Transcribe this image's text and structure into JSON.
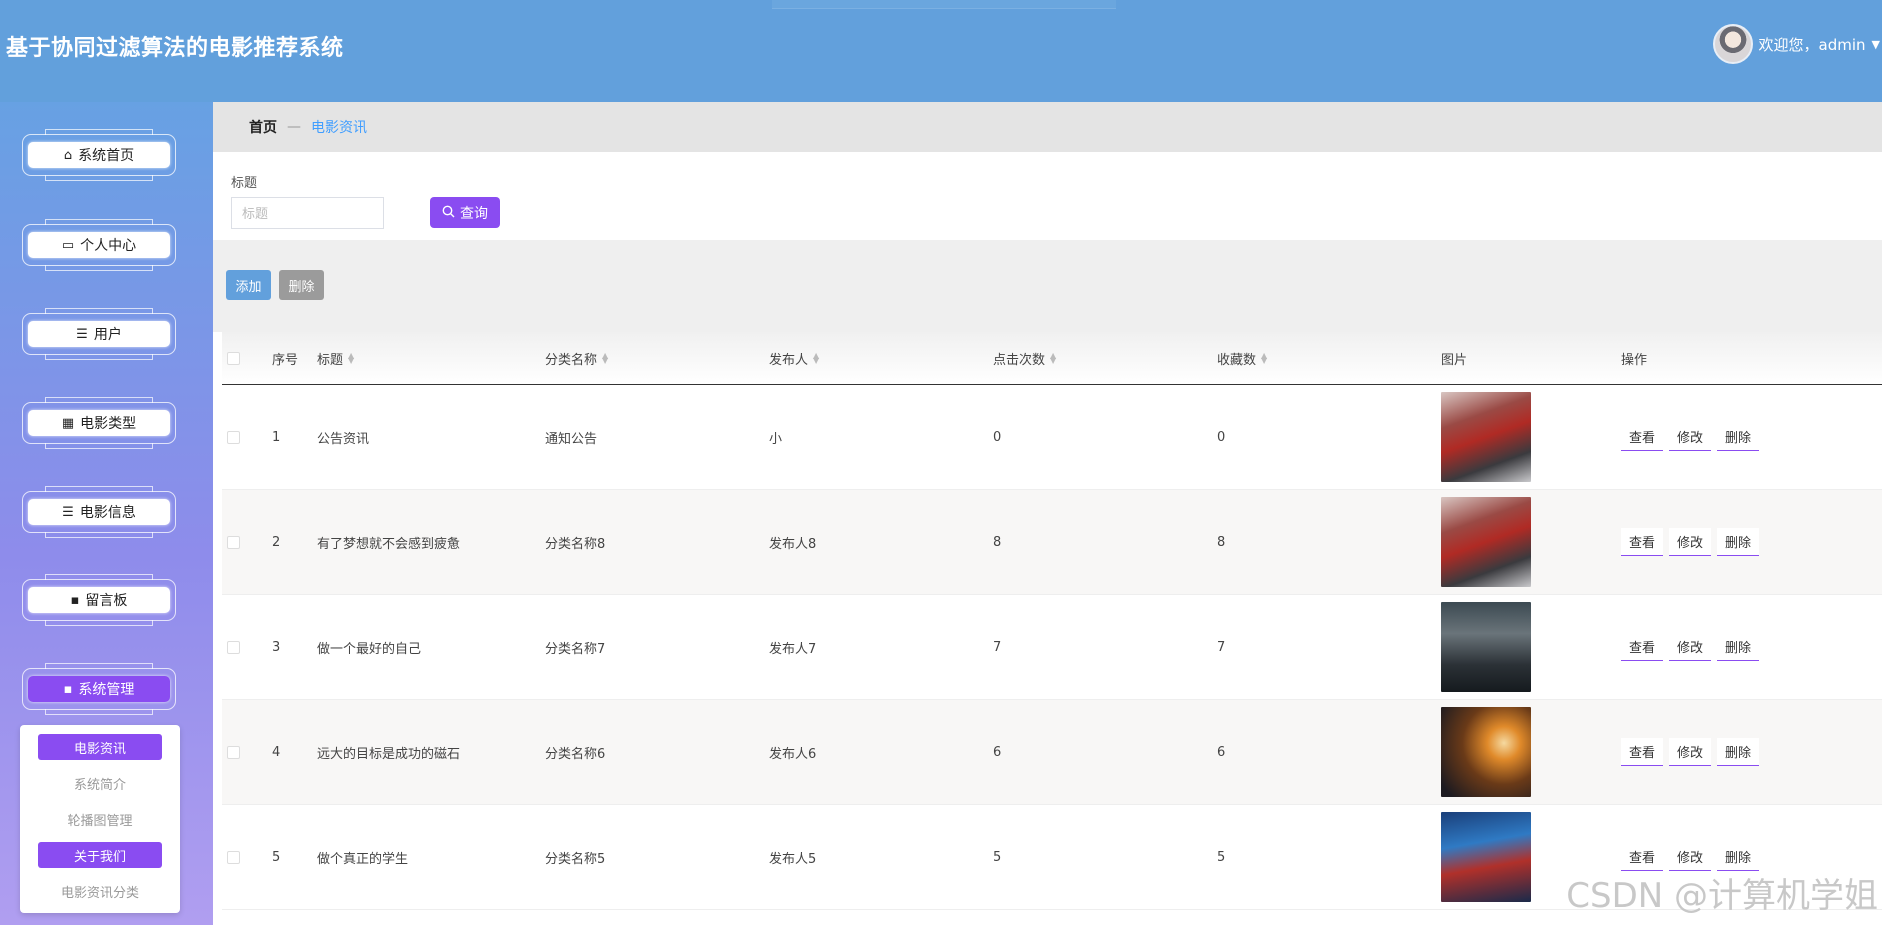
{
  "header": {
    "title": "基于协同过滤算法的电影推荐系统",
    "welcome": "欢迎您，admin",
    "caret": "▼"
  },
  "sidebar": {
    "items": [
      {
        "label": "系统首页",
        "icon": "⌂"
      },
      {
        "label": "个人中心",
        "icon": "▭"
      },
      {
        "label": "用户",
        "icon": "☰"
      },
      {
        "label": "电影类型",
        "icon": "▦"
      },
      {
        "label": "电影信息",
        "icon": "☰"
      },
      {
        "label": "留言板",
        "icon": "▪"
      },
      {
        "label": "系统管理",
        "icon": "▪"
      }
    ],
    "submenu": [
      "电影资讯",
      "系统简介",
      "轮播图管理",
      "关于我们",
      "电影资讯分类"
    ]
  },
  "breadcrumb": {
    "home": "首页",
    "sep": "—",
    "current": "电影资讯"
  },
  "search": {
    "label": "标题",
    "placeholder": "标题",
    "button": "查询"
  },
  "toolbar": {
    "add": "添加",
    "delete": "删除"
  },
  "table": {
    "columns": [
      "序号",
      "标题",
      "分类名称",
      "发布人",
      "点击次数",
      "收藏数",
      "图片",
      "操作"
    ],
    "rows": [
      {
        "index": "1",
        "title": "公告资讯",
        "category": "通知公告",
        "publisher": "小",
        "clicks": "0",
        "favorites": "0",
        "image": "ironman-poster"
      },
      {
        "index": "2",
        "title": "有了梦想就不会感到疲惫",
        "category": "分类名称8",
        "publisher": "发布人8",
        "clicks": "8",
        "favorites": "8",
        "image": "ironman-poster"
      },
      {
        "index": "3",
        "title": "做一个最好的自己",
        "category": "分类名称7",
        "publisher": "发布人7",
        "clicks": "7",
        "favorites": "7",
        "image": "group-poster"
      },
      {
        "index": "4",
        "title": "远大的目标是成功的磁石",
        "category": "分类名称6",
        "publisher": "发布人6",
        "clicks": "6",
        "favorites": "6",
        "image": "transformers-poster"
      },
      {
        "index": "5",
        "title": "做个真正的学生",
        "category": "分类名称5",
        "publisher": "发布人5",
        "clicks": "5",
        "favorites": "5",
        "image": "transformers-blue-poster"
      }
    ],
    "ops": {
      "view": "查看",
      "edit": "修改",
      "delete": "删除"
    }
  },
  "watermark": "CSDN @计算机学姐",
  "colors": {
    "header": "#62a0dc",
    "accent": "#8a4cf1",
    "add": "#62a0dc",
    "delete": "#9b9b9b"
  }
}
